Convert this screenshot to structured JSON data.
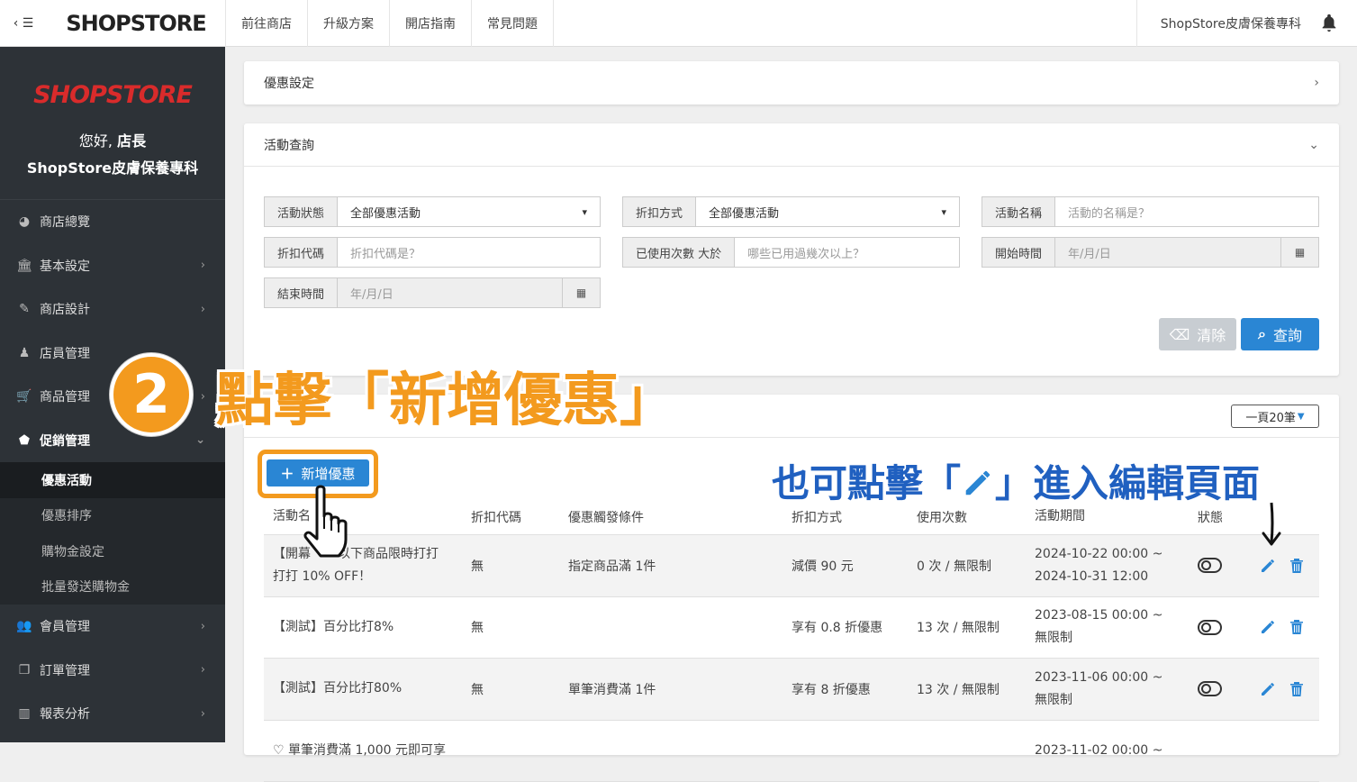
{
  "topbar": {
    "logo": "SHOPSTORE",
    "nav": [
      "前往商店",
      "升級方案",
      "開店指南",
      "常見問題"
    ],
    "store": "ShopStore皮膚保養專科"
  },
  "sidebar": {
    "brand": "SHOPSTORE",
    "greeting": "您好,",
    "role": "店長",
    "store_name": "ShopStore皮膚保養專科",
    "items": [
      {
        "label": "商店總覽",
        "icon": "dashboard-icon"
      },
      {
        "label": "基本設定",
        "icon": "bank-icon"
      },
      {
        "label": "商店設計",
        "icon": "magic-wand-icon"
      },
      {
        "label": "店員管理",
        "icon": "user-lock-icon"
      },
      {
        "label": "商品管理",
        "icon": "cart-icon"
      },
      {
        "label": "促銷管理",
        "icon": "tag-icon"
      },
      {
        "label": "會員管理",
        "icon": "users-icon"
      },
      {
        "label": "訂單管理",
        "icon": "file-icon"
      },
      {
        "label": "報表分析",
        "icon": "bar-chart-icon"
      }
    ],
    "subitems": [
      "優惠活動",
      "優惠排序",
      "購物金設定",
      "批量發送購物金"
    ]
  },
  "discount_settings": {
    "title": "優惠設定"
  },
  "query": {
    "title": "活動查詢",
    "status_label": "活動狀態",
    "status_value": "全部優惠活動",
    "method_label": "折扣方式",
    "method_value": "全部優惠活動",
    "name_label": "活動名稱",
    "name_placeholder": "活動的名稱是？",
    "code_label": "折扣代碼",
    "code_placeholder": "折扣代碼是？",
    "used_label": "已使用次數 大於",
    "used_placeholder": "哪些已用過幾次以上？",
    "start_label": "開始時間",
    "start_placeholder": "年/月/日",
    "end_label": "結束時間",
    "end_placeholder": "年/月/日",
    "clear": "清除",
    "search": "查詢"
  },
  "list": {
    "per_page": "一頁20筆",
    "add_button": "新增優惠",
    "headers": [
      "活動名",
      "折扣代碼",
      "優惠觸發條件",
      "折扣方式",
      "使用次數",
      "活動期間",
      "狀態"
    ],
    "rows": [
      {
        "name_a": "【開幕",
        "name_b": "以下商品限時打打",
        "name_c": "打打 10% OFF！",
        "code": "無",
        "condition": "指定商品滿 1件",
        "method": "減價 90 元",
        "usage": "0 次 / 無限制",
        "period_a": "2024-10-22 00:00 ~",
        "period_b": "2024-10-31 12:00"
      },
      {
        "name_a": "【測試】百分比打8%",
        "name_b": "",
        "name_c": "",
        "code": "無",
        "condition": "",
        "method": "享有 0.8 折優惠",
        "usage": "13 次 / 無限制",
        "period_a": "2023-08-15 00:00 ~",
        "period_b": "無限制"
      },
      {
        "name_a": "【測試】百分比打80%",
        "name_b": "",
        "name_c": "",
        "code": "無",
        "condition": "單筆消費滿 1件",
        "method": "享有 8 折優惠",
        "usage": "13 次 / 無限制",
        "period_a": "2023-11-06 00:00 ~",
        "period_b": "無限制"
      },
      {
        "name_a": "♡ 單筆消費滿 1,000 元即可享",
        "name_b": "",
        "name_c": "",
        "code": "",
        "condition": "",
        "method": "",
        "usage": "",
        "period_a": "2023-11-02 00:00 ~",
        "period_b": ""
      }
    ]
  },
  "annotations": {
    "step_number": "2",
    "step_text": "點擊「新增優惠」",
    "hint_before": "也可點擊「",
    "hint_after": "」進入編輯頁面",
    "accent": "#f39a1e",
    "hint_color": "#2060c0"
  }
}
